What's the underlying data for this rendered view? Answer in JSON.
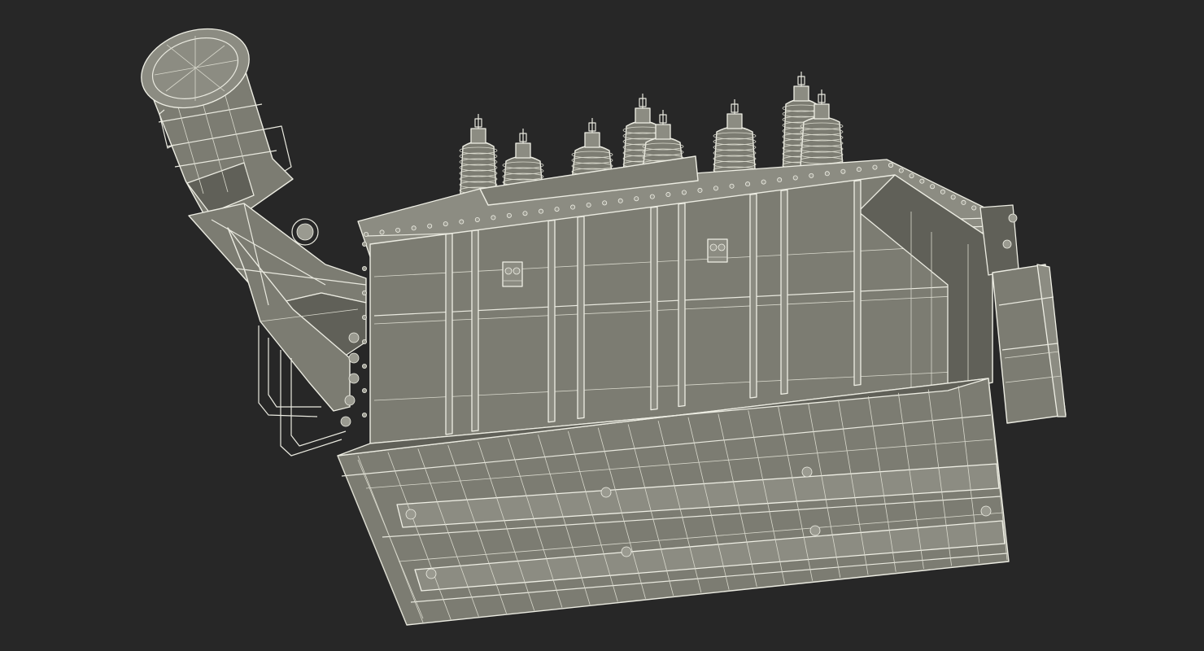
{
  "scene": {
    "background_color": "#272727",
    "model_fill_color": "#7c7c72",
    "wire_color": "#e9e9df",
    "render_style": "wireframe-over-shaded"
  }
}
